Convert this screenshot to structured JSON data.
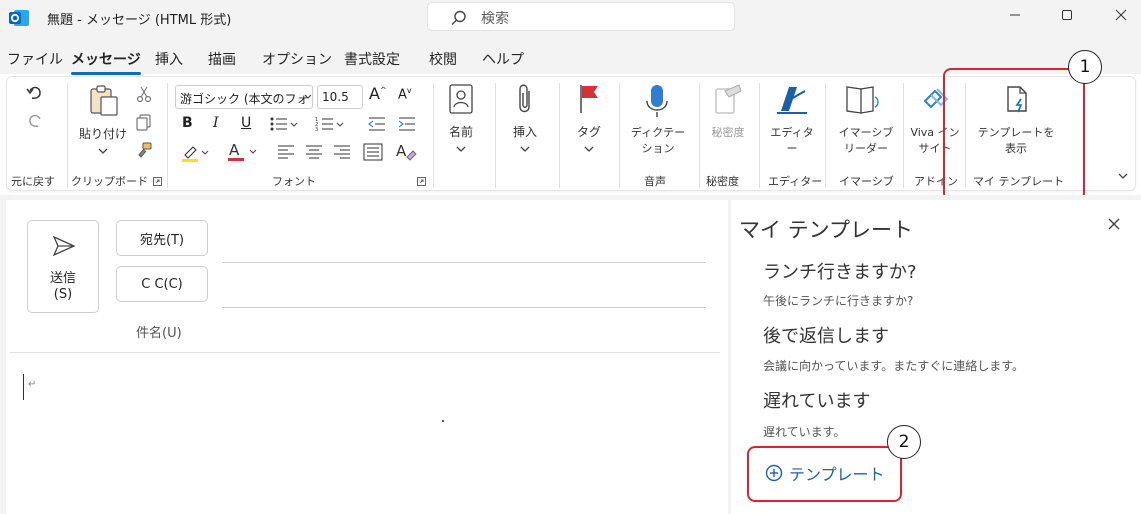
{
  "titlebar": {
    "title": "無題 - メッセージ (HTML 形式)",
    "search_placeholder": "検索"
  },
  "menu": {
    "tabs": [
      "ファイル",
      "メッセージ",
      "挿入",
      "描画",
      "オプション",
      "書式設定",
      "校閲",
      "ヘルプ"
    ],
    "active": "メッセージ"
  },
  "ribbon": {
    "groups": {
      "undo": "元に戻す",
      "clipboard": "クリップボード",
      "font": "フォント",
      "voice": "音声",
      "sensitivity": "秘密度",
      "editor": "エディター",
      "immersive": "イマーシブ",
      "addin": "アドイン",
      "my_templates": "マイ テンプレート"
    },
    "paste": "貼り付け",
    "font_name": "游ゴシック (本文のフォ",
    "font_size": "10.5",
    "name": "名前",
    "insert": "挿入",
    "tag": "タグ",
    "dictate": "ディクテーション",
    "sensitivity_btn": "秘密度",
    "editor_btn": "エディター",
    "immersive_btn": "イマーシブリーダー",
    "viva": "Viva インサイト",
    "show_templates": "テンプレートを表示",
    "accent_color": "#0f6cbd",
    "flag_color": "#d13438"
  },
  "compose": {
    "send": "送信",
    "send_key": "(S)",
    "to": "宛先(T)",
    "cc": "C C(C)",
    "subject": "件名(U)"
  },
  "templates_pane": {
    "title": "マイ テンプレート",
    "items": [
      {
        "title": "ランチ行きますか?",
        "body": "午後にランチに行きますか?"
      },
      {
        "title": "後で返信します",
        "body": "会議に向かっています。またすぐに連絡します。"
      },
      {
        "title": "遅れています",
        "body": "遅れています。"
      }
    ],
    "add_label": "テンプレート"
  },
  "callouts": [
    "1",
    "2"
  ],
  "highlight_color": "#d8262f"
}
